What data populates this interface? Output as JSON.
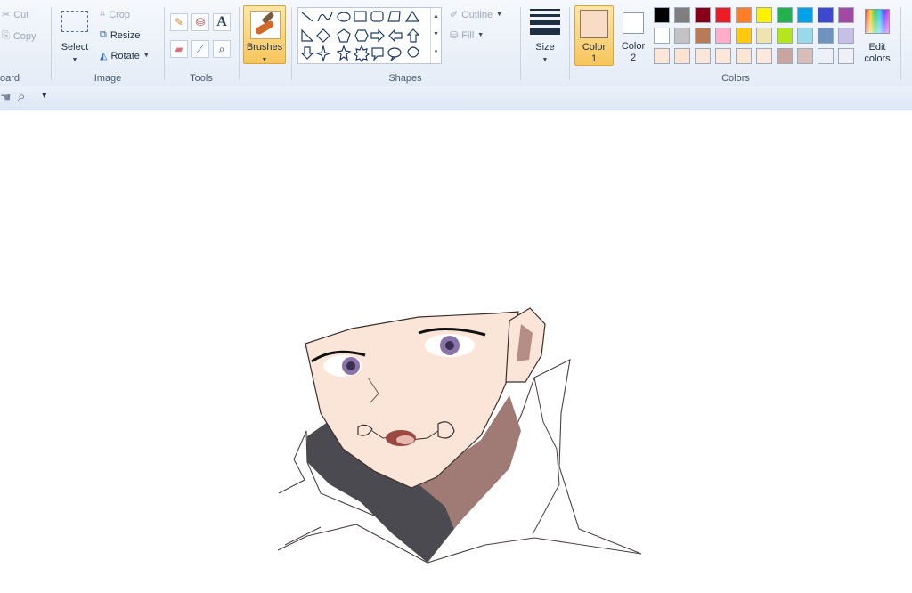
{
  "ribbon": {
    "clipboard": {
      "cut": "Cut",
      "copy": "Copy",
      "label": "oard"
    },
    "image": {
      "select": "Select",
      "crop": "Crop",
      "resize": "Resize",
      "rotate": "Rotate",
      "label": "Image"
    },
    "tools": {
      "label": "Tools",
      "text_glyph": "A"
    },
    "brushes": {
      "label": "Brushes"
    },
    "shapes": {
      "outline": "Outline",
      "fill": "Fill",
      "label": "Shapes"
    },
    "size": {
      "label": "Size"
    },
    "colors": {
      "color1_label": "Color",
      "color1_num": "1",
      "color2_label": "Color",
      "color2_num": "2",
      "edit_label_1": "Edit",
      "edit_label_2": "colors",
      "label": "Colors",
      "color1_value": "#f8dcc6",
      "color2_value": "#ffffff",
      "palette_row1": [
        "#000000",
        "#7f7f7f",
        "#880015",
        "#ed1c24",
        "#ff7f27",
        "#fff200",
        "#22b14c",
        "#00a2e8",
        "#3f48cc",
        "#a349a4"
      ],
      "palette_row2": [
        "#ffffff",
        "#c3c3c3",
        "#b97a57",
        "#ffaec9",
        "#ffc90e",
        "#efe4b0",
        "#b5e61d",
        "#99d9ea",
        "#7092be",
        "#c8bfe7"
      ],
      "palette_row3": [
        "#fde6d6",
        "#fde4d2",
        "#fbe5d8",
        "#fce7da",
        "#fbe5d5",
        "#fde8dc",
        "#c9a59f",
        "#d8bcb8",
        "#eef0f5",
        "#eef0f5"
      ]
    }
  },
  "quick_access": {
    "icons": [
      "pan-icon",
      "zoom-icon",
      "customize-icon"
    ]
  },
  "canvas": {
    "drawing": "anime-character-sketch"
  }
}
